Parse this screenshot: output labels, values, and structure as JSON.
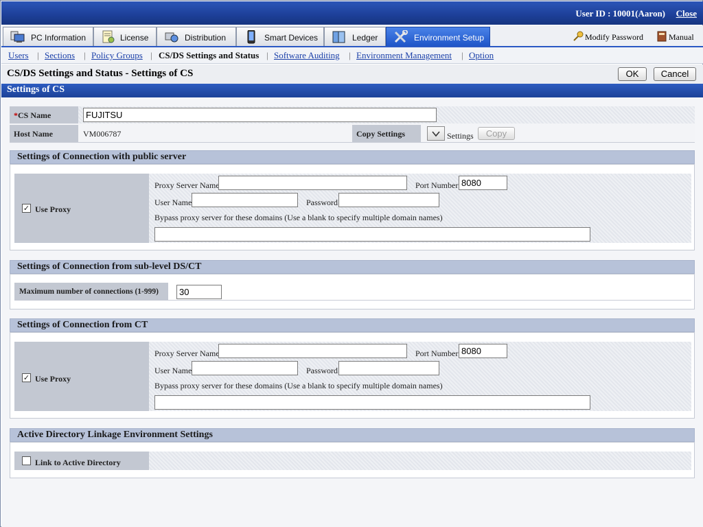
{
  "header": {
    "user_id": "User ID : 10001(Aaron)",
    "close": "Close"
  },
  "tabs": [
    {
      "label": "PC Information",
      "icon": "pc-info-icon"
    },
    {
      "label": "License",
      "icon": "license-icon"
    },
    {
      "label": "Distribution",
      "icon": "distribution-icon"
    },
    {
      "label": "Smart Devices",
      "icon": "smart-device-icon"
    },
    {
      "label": "Ledger",
      "icon": "ledger-icon"
    },
    {
      "label": "Environment Setup",
      "icon": "tools-icon",
      "active": true
    }
  ],
  "toplinks": {
    "modify_password": "Modify Password",
    "manual": "Manual"
  },
  "subnav": [
    "Users",
    "Sections",
    "Policy Groups",
    "CS/DS Settings and Status",
    "Software Auditing",
    "Environment Management",
    "Option"
  ],
  "page": {
    "title": "CS/DS Settings and Status - Settings of CS",
    "ok": "OK",
    "cancel": "Cancel",
    "panel_title": "Settings of CS"
  },
  "cs": {
    "required_mark": "*",
    "name_label": "CS Name",
    "name_value": "FUJITSU",
    "host_label": "Host Name",
    "host_value": "VM006787",
    "copy_label": "Copy Settings",
    "settings_text": "Settings",
    "copy_button": "Copy"
  },
  "public": {
    "title": "Settings of Connection with public server",
    "use_proxy": "Use Proxy",
    "use_proxy_checked": true,
    "proxy_server_label": "Proxy Server Name",
    "proxy_server_value": "",
    "port_label": "Port Number",
    "port_value": "8080",
    "user_label": "User Name",
    "user_value": "",
    "password_label": "Password",
    "bypass_label": "Bypass proxy server for these domains (Use a blank to specify multiple domain names)",
    "bypass_value": ""
  },
  "sublevel": {
    "title": "Settings of Connection from sub-level DS/CT",
    "max_label": "Maximum number of connections (1-999)",
    "max_value": "30"
  },
  "ct": {
    "title": "Settings of Connection from CT",
    "use_proxy": "Use Proxy",
    "use_proxy_checked": true,
    "proxy_server_label": "Proxy Server Name",
    "proxy_server_value": "",
    "port_label": "Port Number",
    "port_value": "8080",
    "user_label": "User Name",
    "user_value": "",
    "password_label": "Password",
    "bypass_label": "Bypass proxy server for these domains (Use a blank to specify multiple domain names)",
    "bypass_value": ""
  },
  "ad": {
    "title": "Active Directory Linkage Environment Settings",
    "link_label": "Link to Active Directory",
    "link_checked": false
  }
}
